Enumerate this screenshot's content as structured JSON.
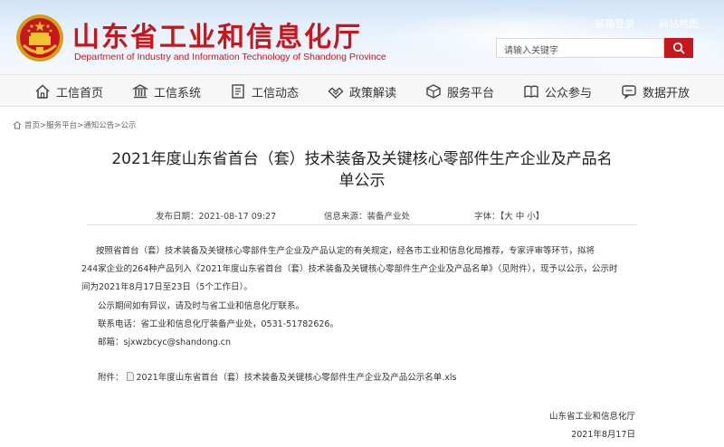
{
  "header": {
    "title": "山东省工业和信息化厅",
    "subtitle": "Department of Industry and Information Technology of Shandong Province",
    "links": [
      "邮箱登录",
      "|",
      "网站地图"
    ],
    "search_placeholder": "请输入关键字",
    "brand_color": "#c8161d"
  },
  "nav": [
    {
      "label": "工信首页",
      "icon": "home-icon"
    },
    {
      "label": "工信系统",
      "icon": "building-icon"
    },
    {
      "label": "工信动态",
      "icon": "document-icon"
    },
    {
      "label": "政策解读",
      "icon": "handshake-icon"
    },
    {
      "label": "服务平台",
      "icon": "cube-icon"
    },
    {
      "label": "公众参与",
      "icon": "book-icon"
    },
    {
      "label": "数据开放",
      "icon": "chat-icon"
    }
  ],
  "breadcrumb": "首页>服务平台>通知公告>公示",
  "article": {
    "title_line1": "2021年度山东省首台（套）技术装备及关键核心零部件生产企业及产品名",
    "title_line2": "单公示",
    "meta_date": "发布日期：2021-08-17 09:27",
    "meta_source": "信息来源：装备产业处",
    "meta_font": "字体：【大 中 小】",
    "paragraph1_line1": "按照省首台（套）技术装备及关键核心零部件生产企业及产品认定的有关规定，经各市工业和信息化局推荐，专家评审等环节，拟将",
    "paragraph1_line2": "244家企业的264种产品列入《2021年度山东省首台（套）技术装备及关键核心零部件生产企业及产品名单》（见附件），现予以公示，公示时",
    "paragraph1_line3": "间为2021年8月17日至23日（5个工作日）。",
    "paragraph2": "公示期间如有异议，请及时与省工业和信息化厅联系。",
    "contact": "联系电话：省工业和信息化厅装备产业处，0531-51782626。",
    "email": "邮箱：sjxwzbcyc@shandong.cn",
    "attachment_label": "附件：",
    "attachment_file": "2021年度山东省首台（套）技术装备及关键核心零部件生产企业及产品公示名单.xls",
    "signature": "山东省工业和信息化厅",
    "date": "2021年8月17日"
  }
}
